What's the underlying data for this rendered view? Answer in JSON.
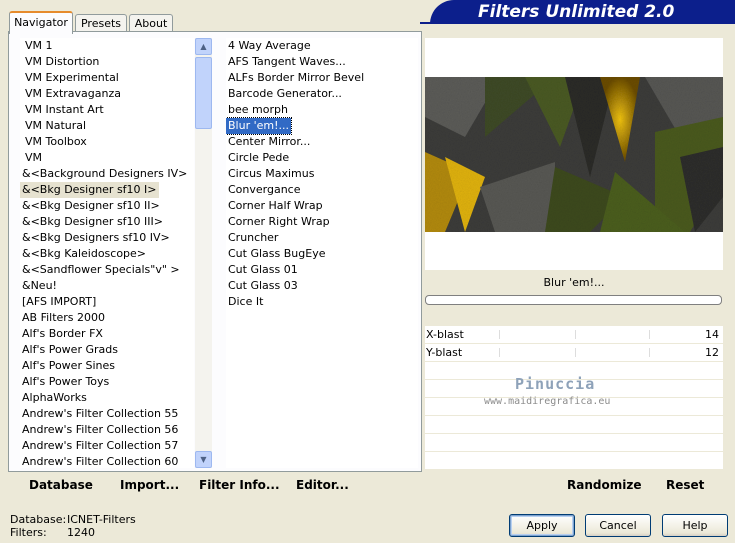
{
  "tabs": [
    {
      "label": "Navigator",
      "active": true
    },
    {
      "label": "Presets",
      "active": false
    },
    {
      "label": "About",
      "active": false
    }
  ],
  "header": {
    "title": "Filters Unlimited 2.0"
  },
  "categories": {
    "items": [
      "VM 1",
      "VM Distortion",
      "VM Experimental",
      "VM Extravaganza",
      "VM Instant Art",
      "VM Natural",
      "VM Toolbox",
      "VM",
      "&<Background Designers IV>",
      "&<Bkg Designer sf10 I>",
      "&<Bkg Designer sf10 II>",
      "&<Bkg Designer sf10 III>",
      "&<Bkg Designers sf10 IV>",
      "&<Bkg Kaleidoscope>",
      "&<Sandflower Specials\"v\" >",
      "&Neu!",
      "[AFS IMPORT]",
      "AB Filters 2000",
      "Alf's Border FX",
      "Alf's Power Grads",
      "Alf's Power Sines",
      "Alf's Power Toys",
      "AlphaWorks",
      "Andrew's Filter Collection 55",
      "Andrew's Filter Collection 56",
      "Andrew's Filter Collection 57",
      "Andrew's Filter Collection 60"
    ],
    "selected_index": 9
  },
  "filters": {
    "items": [
      "4 Way Average",
      "AFS Tangent Waves...",
      "ALFs Border Mirror Bevel",
      "Barcode Generator...",
      "bee morph",
      "Blur 'em!...",
      "Center Mirror...",
      "Circle Pede",
      "Circus Maximus",
      "Convergance",
      "Corner Half Wrap",
      "Corner Right Wrap",
      "Cruncher",
      "Cut Glass  BugEye",
      "Cut Glass 01",
      "Cut Glass 03",
      "Dice It"
    ],
    "selected_index": 5
  },
  "preview": {
    "filter_name": "Blur 'em!..."
  },
  "params": [
    {
      "label": "X-blast",
      "value": "14"
    },
    {
      "label": "Y-blast",
      "value": "12"
    }
  ],
  "watermark": {
    "name": "Pinuccia",
    "url": "www.maidiregrafica.eu"
  },
  "toolbar": {
    "database": "Database",
    "import": "Import...",
    "filter_info": "Filter Info...",
    "editor": "Editor...",
    "randomize": "Randomize",
    "reset": "Reset"
  },
  "status": {
    "database_label": "Database:",
    "database_value": "ICNET-Filters",
    "filters_label": "Filters:",
    "filters_value": "1240"
  },
  "buttons": {
    "apply": "Apply",
    "cancel": "Cancel",
    "help": "Help"
  },
  "colors": {
    "banner": "#0c1f8c",
    "selection": "#316ac5",
    "tab_accent": "#e68b2c"
  }
}
